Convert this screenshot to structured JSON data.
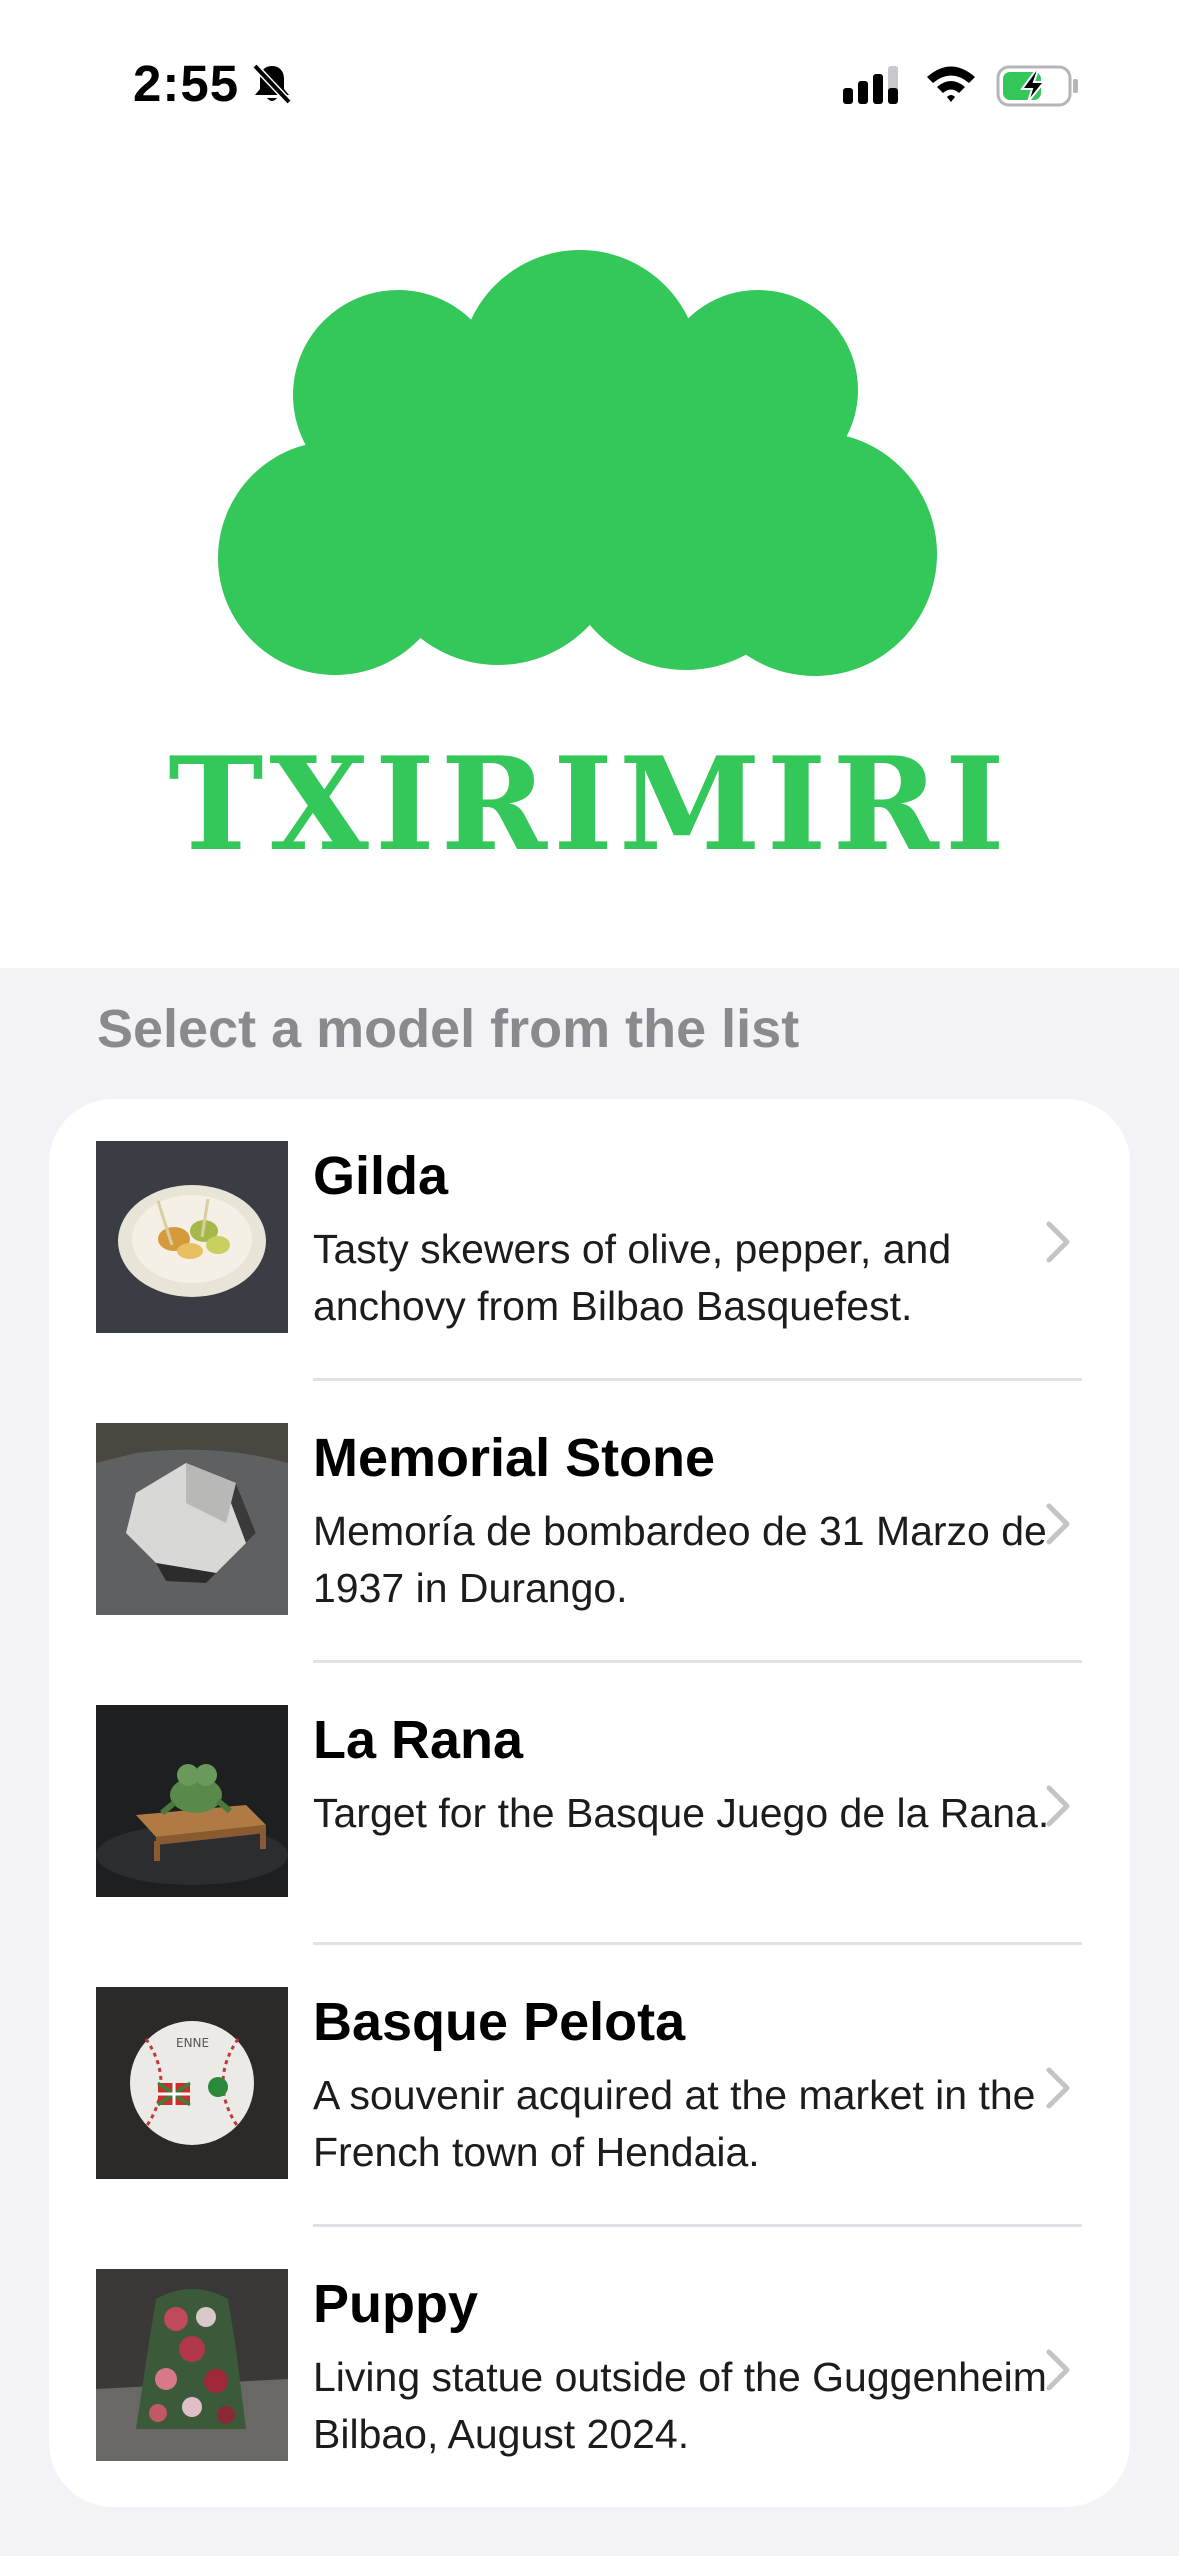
{
  "status_bar": {
    "time": "2:55",
    "icons": [
      "bell-slash-icon",
      "cellular-signal-icon",
      "wifi-icon",
      "battery-charging-icon"
    ]
  },
  "brand": {
    "name": "TXIRIMIRI",
    "logo": "cloud-logo",
    "color": "#34c759"
  },
  "list": {
    "header": "Select a model from the list",
    "items": [
      {
        "title": "Gilda",
        "description": "Tasty skewers of olive, pepper, and anchovy from Bilbao Basquefest.",
        "thumbnail": "gilda-thumbnail"
      },
      {
        "title": "Memorial Stone",
        "description": "Memoría de bombardeo de 31 Marzo de 1937 in Durango.",
        "thumbnail": "memorial-stone-thumbnail"
      },
      {
        "title": "La Rana",
        "description": "Target for the Basque Juego de la Rana.",
        "thumbnail": "la-rana-thumbnail"
      },
      {
        "title": "Basque Pelota",
        "description": "A souvenir acquired at the market in the French town of Hendaia.",
        "thumbnail": "basque-pelota-thumbnail"
      },
      {
        "title": "Puppy",
        "description": "Living statue outside of the Guggenheim Bilbao, August 2024.",
        "thumbnail": "puppy-thumbnail"
      }
    ]
  },
  "colors": {
    "background": "#f2f2f7",
    "card": "#ffffff",
    "header_text": "#8a8a8e",
    "separator": "#e2e2e6",
    "chevron": "#c4c4c7"
  }
}
